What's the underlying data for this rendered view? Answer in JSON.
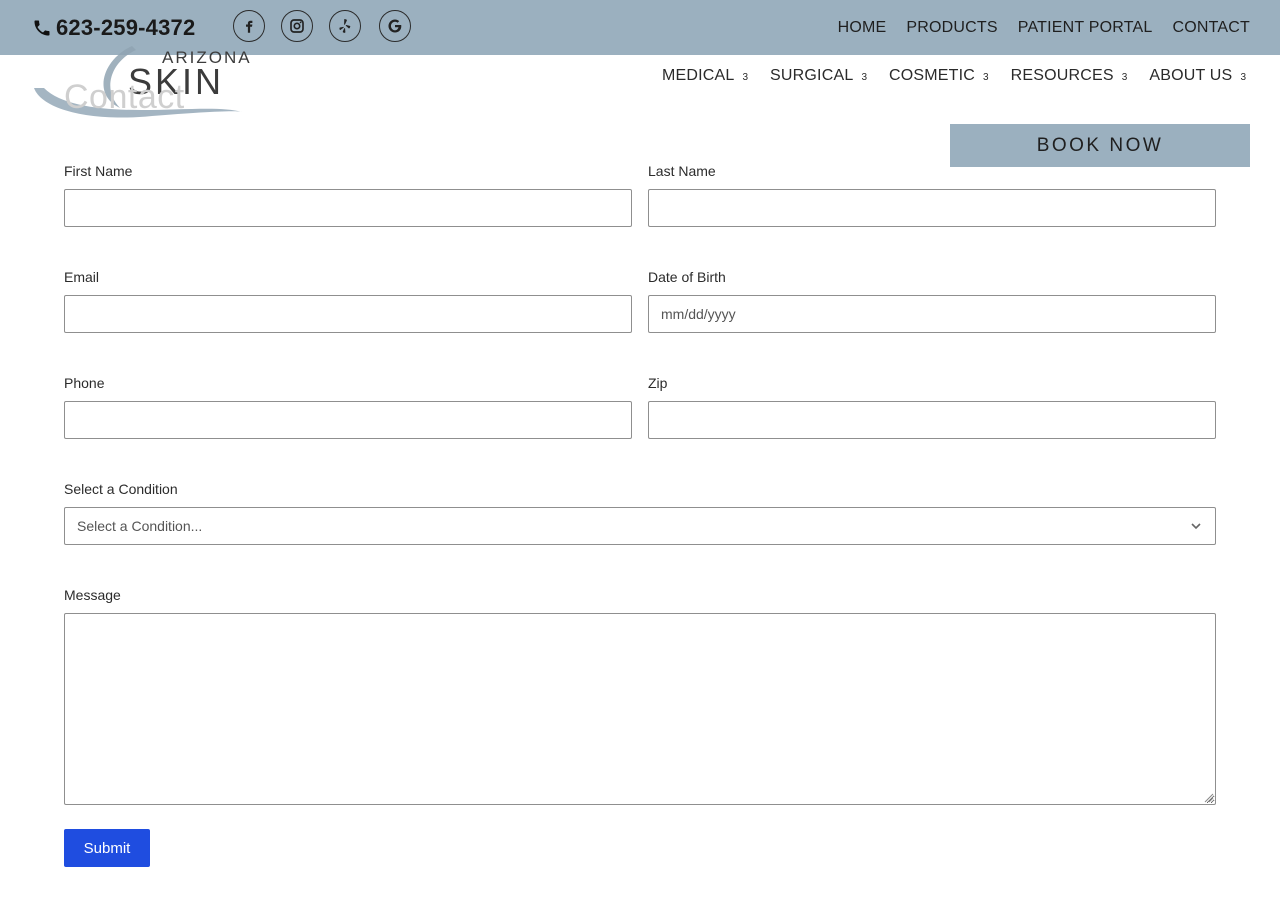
{
  "topbar": {
    "phone": "623-259-4372",
    "phone_icon": "phone-icon",
    "socials": [
      {
        "name": "facebook-icon"
      },
      {
        "name": "instagram-icon"
      },
      {
        "name": "yelp-icon"
      },
      {
        "name": "google-icon"
      }
    ],
    "links": [
      "HOME",
      "PRODUCTS",
      "PATIENT PORTAL",
      "CONTACT"
    ]
  },
  "logo": {
    "line1": "ARIZONA",
    "line2": "SKIN"
  },
  "page_title": "Contact",
  "nav": {
    "items": [
      "MEDICAL",
      "SURGICAL",
      "COSMETIC",
      "RESOURCES",
      "ABOUT US"
    ],
    "caret": "3"
  },
  "book_now": "BOOK NOW",
  "form": {
    "first_name_label": "First Name",
    "last_name_label": "Last Name",
    "email_label": "Email",
    "dob_label": "Date of Birth",
    "dob_placeholder": "mm/dd/yyyy",
    "phone_label": "Phone",
    "zip_label": "Zip",
    "condition_label": "Select a Condition",
    "condition_value": "Select a Condition...",
    "message_label": "Message",
    "submit_label": "Submit"
  },
  "colors": {
    "topbar": "#9bb0bf",
    "submit": "#1f4de0"
  }
}
